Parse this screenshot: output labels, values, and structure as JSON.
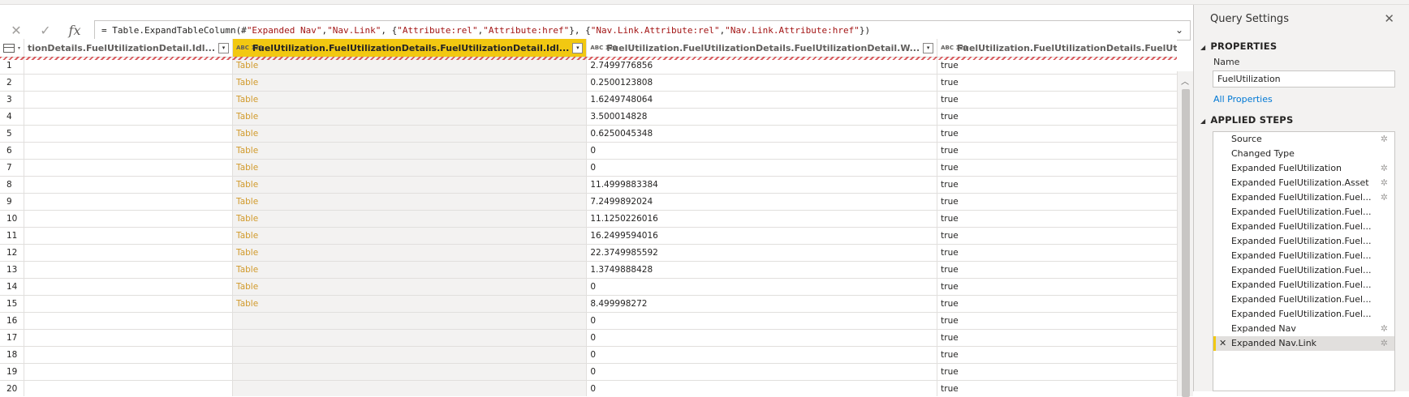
{
  "formula_bar": {
    "cancel_icon": "x-icon",
    "commit_icon": "check-icon",
    "fx_label": "fx",
    "formula_parts": [
      {
        "text": "= Table.ExpandTableColumn(#",
        "kind": "code"
      },
      {
        "text": "\"Expanded Nav\"",
        "kind": "str"
      },
      {
        "text": ", ",
        "kind": "code"
      },
      {
        "text": "\"Nav.Link\"",
        "kind": "str"
      },
      {
        "text": ", {",
        "kind": "code"
      },
      {
        "text": "\"Attribute:rel\"",
        "kind": "str"
      },
      {
        "text": ", ",
        "kind": "code"
      },
      {
        "text": "\"Attribute:href\"",
        "kind": "str"
      },
      {
        "text": "}, {",
        "kind": "code"
      },
      {
        "text": "\"Nav.Link.Attribute:rel\"",
        "kind": "str"
      },
      {
        "text": ", ",
        "kind": "code"
      },
      {
        "text": "\"Nav.Link.Attribute:href\"",
        "kind": "str"
      },
      {
        "text": "})",
        "kind": "code"
      }
    ]
  },
  "grid": {
    "columns": [
      {
        "label": "tionDetails.FuelUtilizationDetail.Idl...",
        "type": "",
        "selected": false
      },
      {
        "label": "FuelUtilization.FuelUtilizationDetails.FuelUtilizationDetail.Idl...",
        "type": "ABC 123",
        "selected": true
      },
      {
        "label": "FuelUtilization.FuelUtilizationDetails.FuelUtilizationDetail.W...",
        "type": "ABC 123",
        "selected": false
      },
      {
        "label": "FuelUtilization.FuelUtilizationDetails.FuelUtilizationDetail.W...",
        "type": "ABC 123",
        "selected": false
      },
      {
        "label": "FuelUtilization.FuelUtiliza",
        "type": "ABC 123",
        "selected": false
      }
    ],
    "rows": [
      [
        "1",
        "",
        "Table",
        "2.7499776856",
        "true",
        "true"
      ],
      [
        "2",
        "",
        "Table",
        "0.2500123808",
        "true",
        "true"
      ],
      [
        "3",
        "",
        "Table",
        "1.6249748064",
        "true",
        "true"
      ],
      [
        "4",
        "",
        "Table",
        "3.500014828",
        "true",
        "true"
      ],
      [
        "5",
        "",
        "Table",
        "0.6250045348",
        "true",
        "true"
      ],
      [
        "6",
        "",
        "Table",
        "0",
        "true",
        "true"
      ],
      [
        "7",
        "",
        "Table",
        "0",
        "true",
        "true"
      ],
      [
        "8",
        "",
        "Table",
        "11.4999883384",
        "true",
        "true"
      ],
      [
        "9",
        "",
        "Table",
        "7.2499892024",
        "true",
        "true"
      ],
      [
        "10",
        "",
        "Table",
        "11.1250226016",
        "true",
        "true"
      ],
      [
        "11",
        "",
        "Table",
        "16.2499594016",
        "true",
        "true"
      ],
      [
        "12",
        "",
        "Table",
        "22.3749985592",
        "true",
        "true"
      ],
      [
        "13",
        "",
        "Table",
        "1.3749888428",
        "true",
        "true"
      ],
      [
        "14",
        "",
        "Table",
        "0",
        "true",
        "true"
      ],
      [
        "15",
        "",
        "Table",
        "8.499998272",
        "true",
        "true"
      ],
      [
        "16",
        "",
        "",
        "0",
        "true",
        "true"
      ],
      [
        "17",
        "",
        "",
        "0",
        "true",
        "true"
      ],
      [
        "18",
        "",
        "",
        "0",
        "true",
        "true"
      ],
      [
        "19",
        "",
        "",
        "0",
        "true",
        "true"
      ],
      [
        "20",
        "",
        "",
        "0",
        "true",
        "true"
      ]
    ]
  },
  "panel": {
    "title": "Query Settings",
    "properties_heading": "PROPERTIES",
    "name_label": "Name",
    "name_value": "FuelUtilization",
    "all_properties": "All Properties",
    "applied_steps_heading": "APPLIED STEPS",
    "steps": [
      {
        "label": "Source",
        "gear": true,
        "selected": false
      },
      {
        "label": "Changed Type",
        "gear": false,
        "selected": false
      },
      {
        "label": "Expanded FuelUtilization",
        "gear": true,
        "selected": false
      },
      {
        "label": "Expanded FuelUtilization.Asset",
        "gear": true,
        "selected": false
      },
      {
        "label": "Expanded FuelUtilization.Fuel...",
        "gear": true,
        "selected": false
      },
      {
        "label": "Expanded FuelUtilization.Fuel...",
        "gear": false,
        "selected": false
      },
      {
        "label": "Expanded FuelUtilization.Fuel...",
        "gear": false,
        "selected": false
      },
      {
        "label": "Expanded FuelUtilization.Fuel...",
        "gear": false,
        "selected": false
      },
      {
        "label": "Expanded FuelUtilization.Fuel...",
        "gear": false,
        "selected": false
      },
      {
        "label": "Expanded FuelUtilization.Fuel...",
        "gear": false,
        "selected": false
      },
      {
        "label": "Expanded FuelUtilization.Fuel...",
        "gear": false,
        "selected": false
      },
      {
        "label": "Expanded FuelUtilization.Fuel...",
        "gear": false,
        "selected": false
      },
      {
        "label": "Expanded FuelUtilization.Fuel...",
        "gear": false,
        "selected": false
      },
      {
        "label": "Expanded Nav",
        "gear": true,
        "selected": false
      },
      {
        "label": "Expanded Nav.Link",
        "gear": true,
        "selected": true
      }
    ]
  },
  "colors": {
    "accent": "#f2c811",
    "link": "#0078d4",
    "table_text": "#d19a2b",
    "string": "#a31515"
  }
}
